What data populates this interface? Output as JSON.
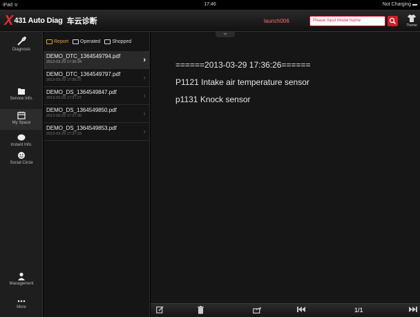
{
  "status_bar": {
    "left": "iPad ᯤ",
    "time": "17:46",
    "right": "Not Charging ▬"
  },
  "header": {
    "logo_mark": "X",
    "app_name": "431 Auto Diag",
    "app_name_cn": "车云诊断",
    "username": "launch006",
    "search_placeholder": "Please Input Model Name",
    "theme_label": "Theme"
  },
  "nav": {
    "items": [
      {
        "label": "Diagnosis",
        "icon": "wrench-icon"
      },
      {
        "label": "Service Info.",
        "icon": "folder-icon"
      },
      {
        "label": "My Space",
        "icon": "calendar-icon"
      },
      {
        "label": "Instant Info.",
        "icon": "chat-bubble-icon"
      },
      {
        "label": "Social Circle",
        "icon": "smiley-icon"
      },
      {
        "label": "Management",
        "icon": "person-icon"
      },
      {
        "label": "More",
        "icon": "more-dots-icon"
      }
    ]
  },
  "list_tabs": {
    "report": "Report",
    "operated": "Operated",
    "shopped": "Shopped"
  },
  "files": [
    {
      "name": "DEMO_DTC_1364549794.pdf",
      "date": "2013-03-29 17:36:34"
    },
    {
      "name": "DEMO_DTC_1364549797.pdf",
      "date": "2013-03-29 17:36:37"
    },
    {
      "name": "DEMO_DS_1364549847.pdf",
      "date": "2013-03-29 17:37:27"
    },
    {
      "name": "DEMO_DS_1364549850.pdf",
      "date": "2013-03-29 17:37:30"
    },
    {
      "name": "DEMO_DS_1364549853.pdf",
      "date": "2013-03-29 17:37:33"
    }
  ],
  "report": {
    "header_line": "======2013-03-29 17:36:26======",
    "lines": [
      "P1121 Intake air temperature sensor",
      "p1131 Knock sensor"
    ]
  },
  "toolbar": {
    "page_indicator": "1/1"
  },
  "colors": {
    "accent_red": "#d41d2a",
    "active_tab": "#e8a33a"
  }
}
